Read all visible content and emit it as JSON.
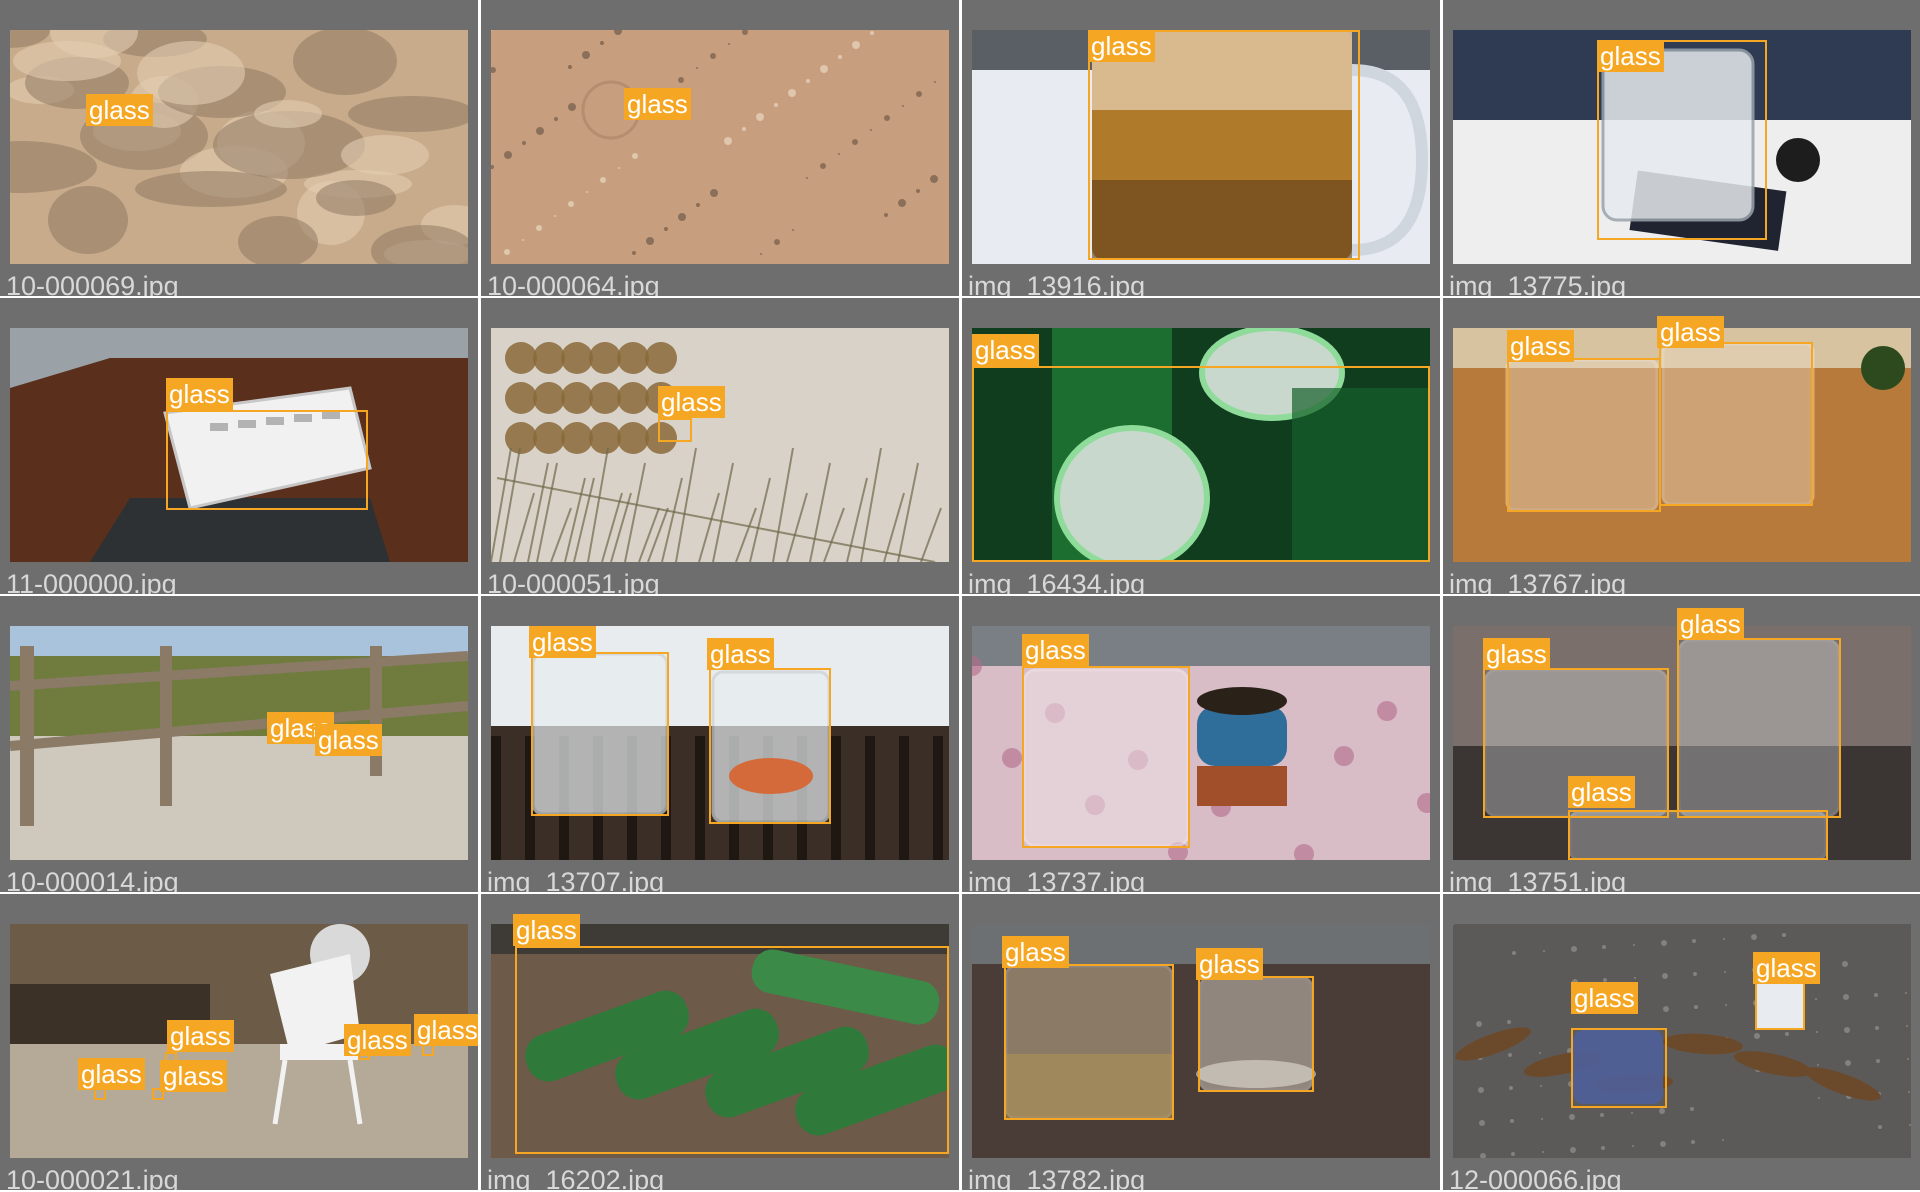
{
  "grid": {
    "cells": [
      {
        "filename": "10-000069.jpg",
        "scene": "sand",
        "labels": [
          "glass"
        ]
      },
      {
        "filename": "10-000064.jpg",
        "scene": "sand-pebbles",
        "labels": [
          "glass"
        ]
      },
      {
        "filename": "img_13916.jpg",
        "scene": "beer-mug",
        "labels": [
          "glass"
        ]
      },
      {
        "filename": "img_13775.jpg",
        "scene": "glass-mug-table",
        "labels": [
          "glass"
        ]
      },
      {
        "filename": "11-000000.jpg",
        "scene": "elevator-tray",
        "labels": [
          "glass"
        ]
      },
      {
        "filename": "10-000051.jpg",
        "scene": "dune-plants",
        "labels": [
          "glass"
        ]
      },
      {
        "filename": "img_16434.jpg",
        "scene": "green-bottles",
        "labels": [
          "glass"
        ]
      },
      {
        "filename": "img_13767.jpg",
        "scene": "two-mugs",
        "labels": [
          "glass",
          "glass"
        ]
      },
      {
        "filename": "10-000014.jpg",
        "scene": "fence-beach",
        "labels": [
          "glass",
          "glass"
        ]
      },
      {
        "filename": "img_13707.jpg",
        "scene": "mug-and-cup",
        "labels": [
          "glass",
          "glass"
        ]
      },
      {
        "filename": "img_13737.jpg",
        "scene": "pink-tablecloth",
        "labels": [
          "glass"
        ]
      },
      {
        "filename": "img_13751.jpg",
        "scene": "three-mugs",
        "labels": [
          "glass",
          "glass",
          "glass"
        ]
      },
      {
        "filename": "10-000021.jpg",
        "scene": "backyard-chair",
        "labels": [
          "glass",
          "glass",
          "glass",
          "glass",
          "glass"
        ]
      },
      {
        "filename": "img_16202.jpg",
        "scene": "bottles-table",
        "labels": [
          "glass"
        ]
      },
      {
        "filename": "img_13782.jpg",
        "scene": "tea-cups",
        "labels": [
          "glass",
          "glass"
        ]
      },
      {
        "filename": "12-000066.jpg",
        "scene": "litter-ground",
        "labels": [
          "glass",
          "glass"
        ]
      }
    ]
  },
  "colors": {
    "cell_background": "#6e6e6e",
    "box": "#f5a623",
    "label_text": "#ffffff",
    "filename_text": "#d8d8d8"
  }
}
